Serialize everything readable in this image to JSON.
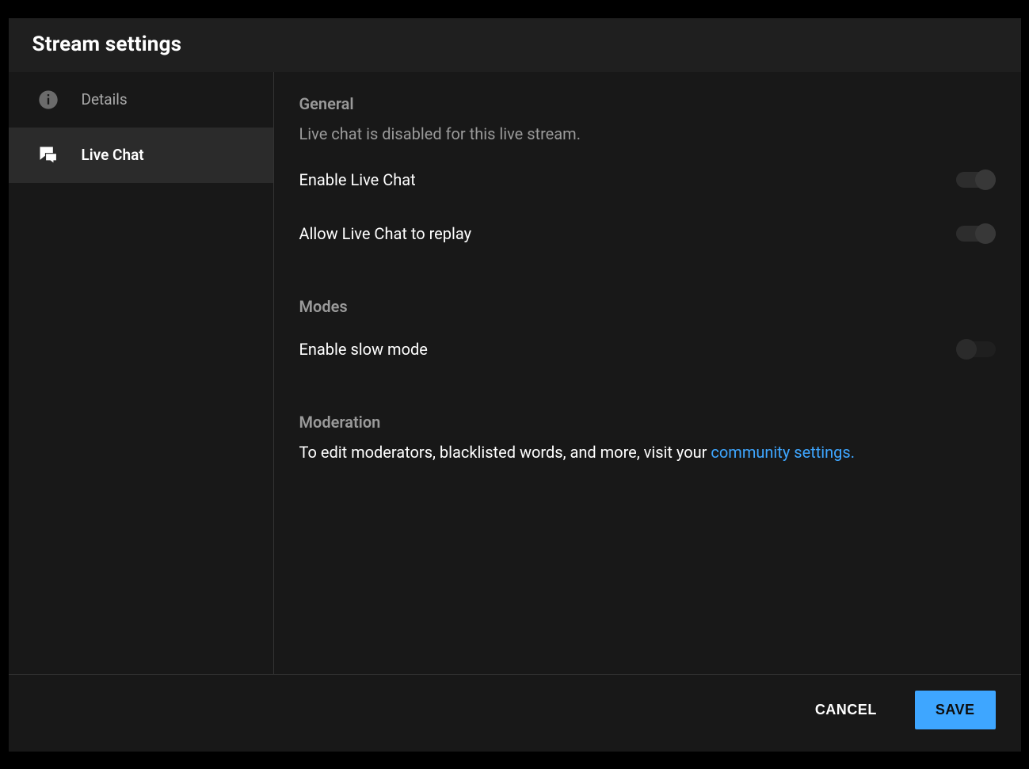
{
  "dialog": {
    "title": "Stream settings"
  },
  "sidebar": {
    "items": [
      {
        "label": "Details"
      },
      {
        "label": "Live Chat"
      }
    ]
  },
  "sections": {
    "general": {
      "heading": "General",
      "description": "Live chat is disabled for this live stream.",
      "enable_live_chat": "Enable Live Chat",
      "allow_replay": "Allow Live Chat to replay"
    },
    "modes": {
      "heading": "Modes",
      "enable_slow_mode": "Enable slow mode"
    },
    "moderation": {
      "heading": "Moderation",
      "text_before": "To edit moderators, blacklisted words, and more, visit your ",
      "link_text": "community settings."
    }
  },
  "footer": {
    "cancel": "CANCEL",
    "save": "SAVE"
  },
  "colors": {
    "accent": "#3ea6ff"
  }
}
